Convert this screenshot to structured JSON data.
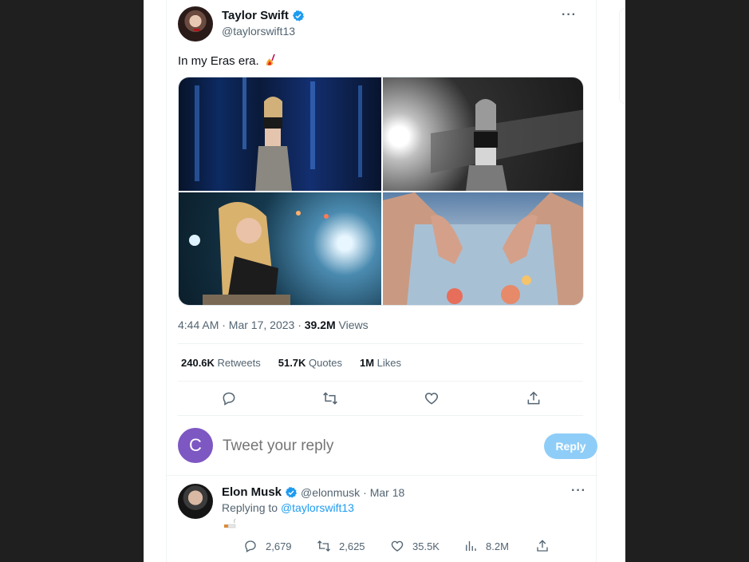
{
  "tweet": {
    "author_name": "Taylor Swift",
    "author_handle": "@taylorswift13",
    "text": "In my Eras era.",
    "timestamp": "4:44 AM · Mar 17, 2023 · ",
    "views_count": "39.2M",
    "views_label": " Views",
    "stats": [
      {
        "value": "240.6K",
        "label": " Retweets"
      },
      {
        "value": "51.7K",
        "label": " Quotes"
      },
      {
        "value": "1M",
        "label": " Likes"
      }
    ],
    "more_icon": "more-horizontal-icon"
  },
  "reply_box": {
    "avatar_letter": "C",
    "placeholder": "Tweet your reply",
    "button_label": "Reply"
  },
  "reply": {
    "author_name": "Elon Musk",
    "author_handle": "@elonmusk",
    "date": "· Mar 18",
    "replying_prefix": "Replying to ",
    "replying_to": "@taylorswift13",
    "stats": {
      "replies": "2,679",
      "retweets": "2,625",
      "likes": "35.5K",
      "views": "8.2M"
    }
  },
  "colors": {
    "accent": "#1d9bf0",
    "reply_button": "#8ecdf8",
    "avatar_bg": "#7d57c2",
    "secondary_text": "#536471"
  }
}
